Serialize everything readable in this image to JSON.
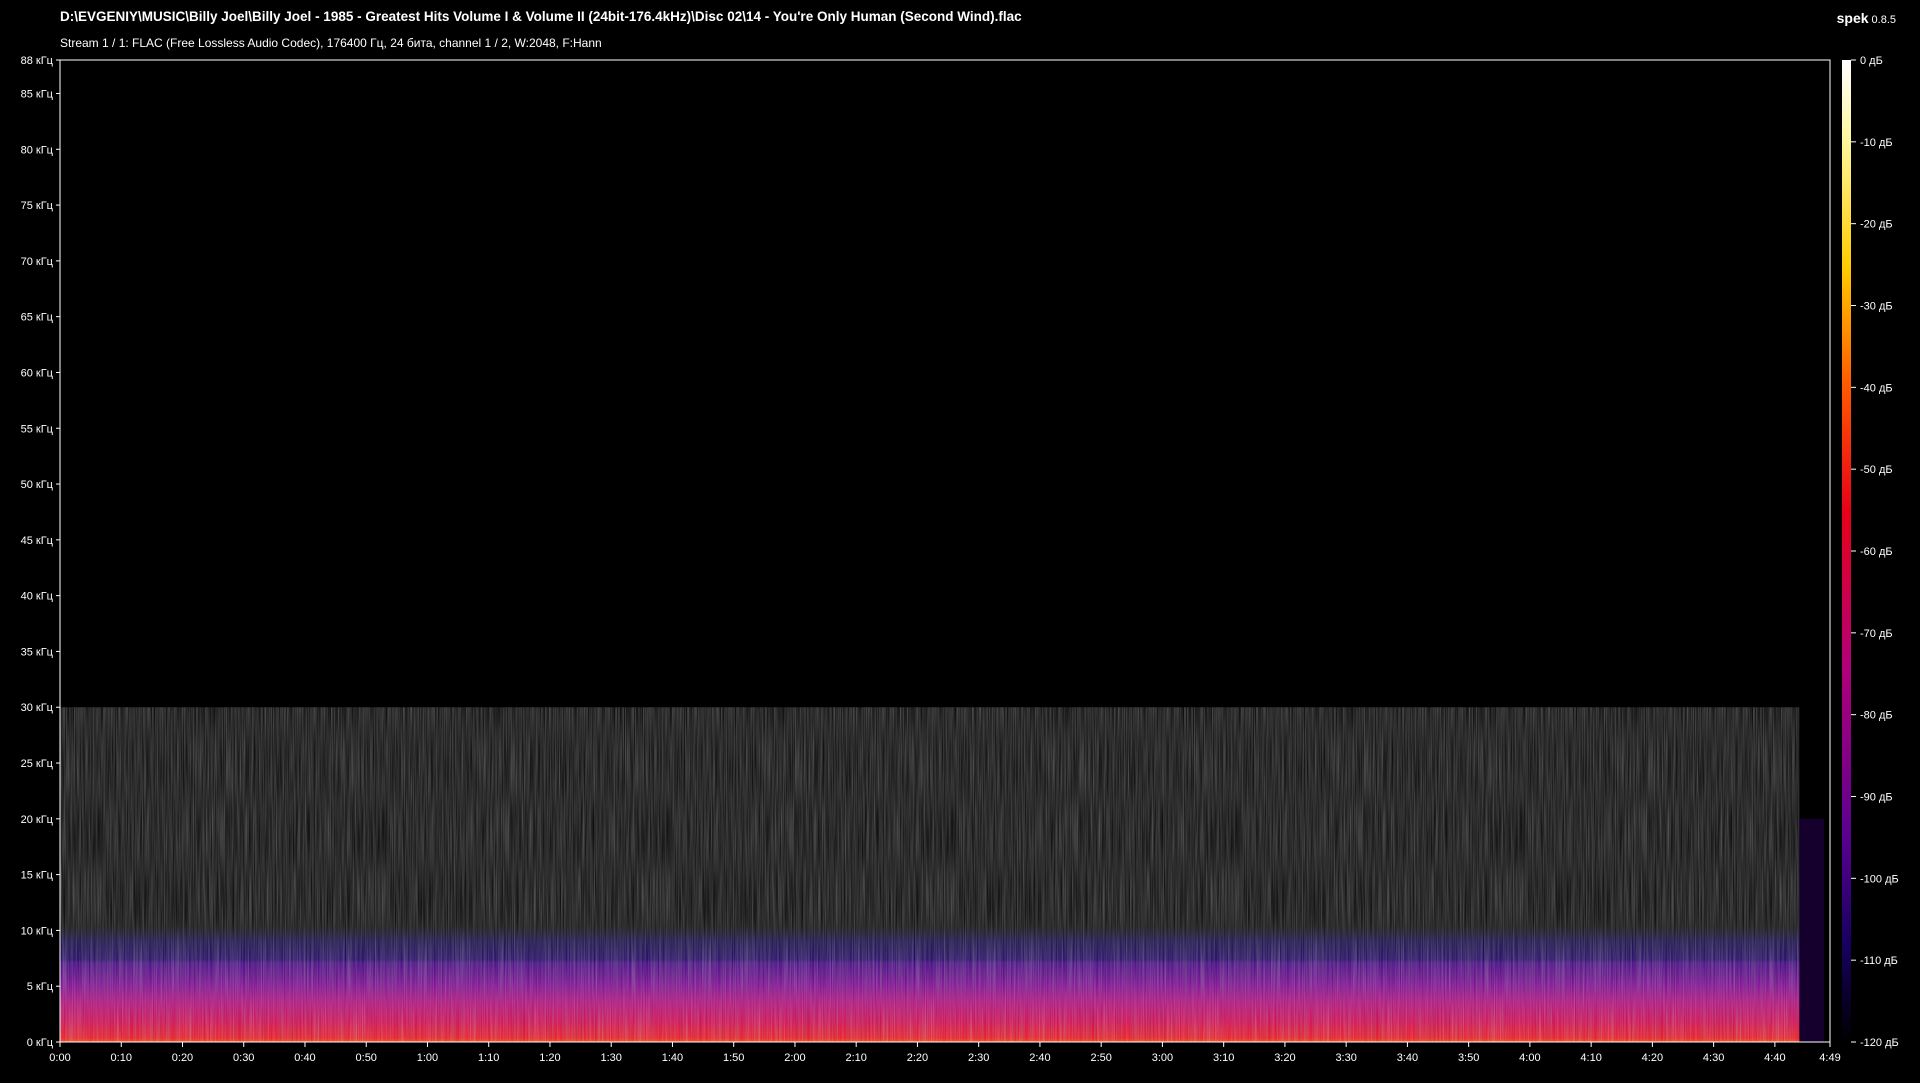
{
  "window": {
    "title": "D:\\EVGENIY\\MUSIC\\Billy Joel\\Billy Joel - 1985 - Greatest Hits Volume I & Volume II (24bit-176.4kHz)\\Disc 02\\14 - You're Only Human (Second Wind).flac",
    "stream_info": "Stream 1 / 1: FLAC (Free Lossless Audio Codec), 176400 Гц, 24 бита, channel 1 / 2, W:2048, F:Hann",
    "app_name": "spek",
    "app_version": "0.8.5"
  },
  "chart_data": {
    "type": "heatmap",
    "frequency_axis": {
      "unit": "кГц",
      "range": [
        0,
        88
      ],
      "ticks": [
        {
          "value": 0,
          "label": "0 кГц"
        },
        {
          "value": 5,
          "label": "5 кГц"
        },
        {
          "value": 10,
          "label": "10 кГц"
        },
        {
          "value": 15,
          "label": "15 кГц"
        },
        {
          "value": 20,
          "label": "20 кГц"
        },
        {
          "value": 25,
          "label": "25 кГц"
        },
        {
          "value": 30,
          "label": "30 кГц"
        },
        {
          "value": 35,
          "label": "35 кГц"
        },
        {
          "value": 40,
          "label": "40 кГц"
        },
        {
          "value": 45,
          "label": "45 кГц"
        },
        {
          "value": 50,
          "label": "50 кГц"
        },
        {
          "value": 55,
          "label": "55 кГц"
        },
        {
          "value": 60,
          "label": "60 кГц"
        },
        {
          "value": 65,
          "label": "65 кГц"
        },
        {
          "value": 70,
          "label": "70 кГц"
        },
        {
          "value": 75,
          "label": "75 кГц"
        },
        {
          "value": 80,
          "label": "80 кГц"
        },
        {
          "value": 85,
          "label": "85 кГц"
        },
        {
          "value": 88,
          "label": "88 кГц"
        }
      ]
    },
    "time_axis": {
      "unit": "seconds",
      "range": [
        0,
        289
      ],
      "ticks": [
        {
          "value": 0,
          "label": "0:00"
        },
        {
          "value": 10,
          "label": "0:10"
        },
        {
          "value": 20,
          "label": "0:20"
        },
        {
          "value": 30,
          "label": "0:30"
        },
        {
          "value": 40,
          "label": "0:40"
        },
        {
          "value": 50,
          "label": "0:50"
        },
        {
          "value": 60,
          "label": "1:00"
        },
        {
          "value": 70,
          "label": "1:10"
        },
        {
          "value": 80,
          "label": "1:20"
        },
        {
          "value": 90,
          "label": "1:30"
        },
        {
          "value": 100,
          "label": "1:40"
        },
        {
          "value": 110,
          "label": "1:50"
        },
        {
          "value": 120,
          "label": "2:00"
        },
        {
          "value": 130,
          "label": "2:10"
        },
        {
          "value": 140,
          "label": "2:20"
        },
        {
          "value": 150,
          "label": "2:30"
        },
        {
          "value": 160,
          "label": "2:40"
        },
        {
          "value": 170,
          "label": "2:50"
        },
        {
          "value": 180,
          "label": "3:00"
        },
        {
          "value": 190,
          "label": "3:10"
        },
        {
          "value": 200,
          "label": "3:20"
        },
        {
          "value": 210,
          "label": "3:30"
        },
        {
          "value": 220,
          "label": "3:40"
        },
        {
          "value": 230,
          "label": "3:50"
        },
        {
          "value": 240,
          "label": "4:00"
        },
        {
          "value": 250,
          "label": "4:10"
        },
        {
          "value": 260,
          "label": "4:20"
        },
        {
          "value": 270,
          "label": "4:30"
        },
        {
          "value": 280,
          "label": "4:40"
        },
        {
          "value": 289,
          "label": "4:49"
        }
      ]
    },
    "level_axis": {
      "unit": "дБ",
      "range": [
        -120,
        0
      ],
      "ticks": [
        {
          "value": 0,
          "label": "0 дБ"
        },
        {
          "value": -10,
          "label": "-10 дБ"
        },
        {
          "value": -20,
          "label": "-20 дБ"
        },
        {
          "value": -30,
          "label": "-30 дБ"
        },
        {
          "value": -40,
          "label": "-40 дБ"
        },
        {
          "value": -50,
          "label": "-50 дБ"
        },
        {
          "value": -60,
          "label": "-60 дБ"
        },
        {
          "value": -70,
          "label": "-70 дБ"
        },
        {
          "value": -80,
          "label": "-80 дБ"
        },
        {
          "value": -90,
          "label": "-90 дБ"
        },
        {
          "value": -100,
          "label": "-100 дБ"
        },
        {
          "value": -110,
          "label": "-110 дБ"
        },
        {
          "value": -120,
          "label": "-120 дБ"
        }
      ],
      "colormap": [
        {
          "db": 0,
          "color": "#ffffff"
        },
        {
          "db": -10,
          "color": "#fff7a0"
        },
        {
          "db": -25,
          "color": "#ffcc00"
        },
        {
          "db": -40,
          "color": "#ff5a00"
        },
        {
          "db": -55,
          "color": "#e80018"
        },
        {
          "db": -75,
          "color": "#b0007a"
        },
        {
          "db": -95,
          "color": "#5a0090"
        },
        {
          "db": -108,
          "color": "#160060"
        },
        {
          "db": -120,
          "color": "#000000"
        }
      ]
    },
    "spectrum_profile": {
      "description_note": "",
      "bands": [
        {
          "freq_from": 0,
          "freq_to": 1,
          "level_db": -45
        },
        {
          "freq_from": 1,
          "freq_to": 4,
          "level_db": -55
        },
        {
          "freq_from": 4,
          "freq_to": 10,
          "level_db": -68
        },
        {
          "freq_from": 10,
          "freq_to": 15,
          "level_db": -80
        },
        {
          "freq_from": 15,
          "freq_to": 21,
          "level_db": -92
        },
        {
          "freq_from": 21,
          "freq_to": 30,
          "level_db": -106
        },
        {
          "freq_from": 30,
          "freq_to": 88,
          "level_db": -120
        }
      ],
      "track_end_seconds": 284
    }
  }
}
